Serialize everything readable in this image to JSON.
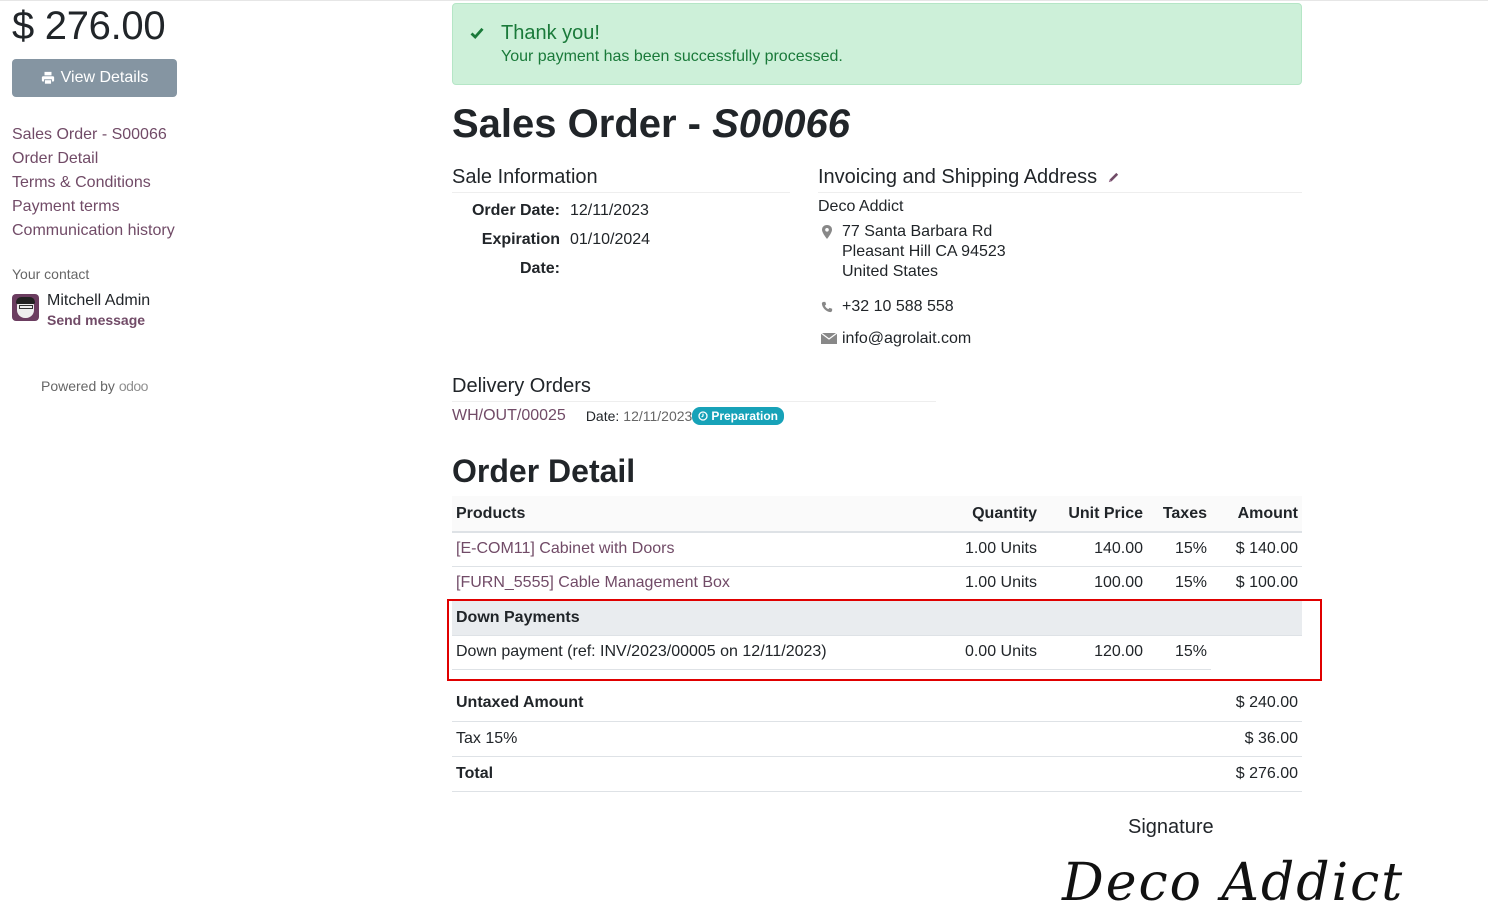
{
  "sidebar": {
    "amount": "$ 276.00",
    "view_details_label": "View Details",
    "nav": [
      "Sales Order - S00066",
      "Order Detail",
      "Terms & Conditions",
      "Payment terms",
      "Communication history"
    ],
    "contact_label": "Your contact",
    "contact_name": "Mitchell Admin",
    "send_message_label": "Send message",
    "powered_by": "Powered by",
    "brand": "odoo"
  },
  "alert": {
    "title": "Thank you!",
    "message": "Your payment has been successfully processed."
  },
  "order": {
    "title_prefix": "Sales Order - ",
    "number": "S00066"
  },
  "sale_information": {
    "heading": "Sale Information",
    "order_date_label": "Order Date:",
    "order_date": "12/11/2023",
    "expiration_date_label": "Expiration Date:",
    "expiration_date": "01/10/2024"
  },
  "address": {
    "heading": "Invoicing and Shipping Address",
    "name": "Deco Addict",
    "street": "77 Santa Barbara Rd",
    "city": "Pleasant Hill CA 94523",
    "country": "United States",
    "phone": "+32 10 588 558",
    "email": "info@agrolait.com"
  },
  "delivery": {
    "heading": "Delivery Orders",
    "reference": "WH/OUT/00025",
    "date_label": "Date:",
    "date": "12/11/2023",
    "status": "Preparation",
    "status_color": "#17a2b8"
  },
  "order_detail": {
    "heading": "Order Detail",
    "columns": [
      "Products",
      "Quantity",
      "Unit Price",
      "Taxes",
      "Amount"
    ],
    "lines": [
      {
        "product": "[E-COM11] Cabinet with Doors",
        "quantity": "1.00 Units",
        "unit_price": "140.00",
        "taxes": "15%",
        "amount": "$ 140.00"
      },
      {
        "product": "[FURN_5555] Cable Management Box",
        "quantity": "1.00 Units",
        "unit_price": "100.00",
        "taxes": "15%",
        "amount": "$ 100.00"
      }
    ],
    "section": "Down Payments",
    "down_payment": {
      "product": "Down payment (ref: INV/2023/00005 on 12/11/2023)",
      "quantity": "0.00 Units",
      "unit_price": "120.00",
      "taxes": "15%",
      "amount": ""
    }
  },
  "totals": {
    "untaxed_label": "Untaxed Amount",
    "untaxed": "$ 240.00",
    "tax_label": "Tax 15%",
    "tax": "$ 36.00",
    "total_label": "Total",
    "total": "$ 276.00"
  },
  "signature": {
    "label": "Signature",
    "signed_name": "Deco Addict"
  },
  "colors": {
    "brand": "#714b67",
    "success_bg": "#cdf0d9",
    "success_text": "#1a7a3a",
    "highlight": "#e00000"
  }
}
